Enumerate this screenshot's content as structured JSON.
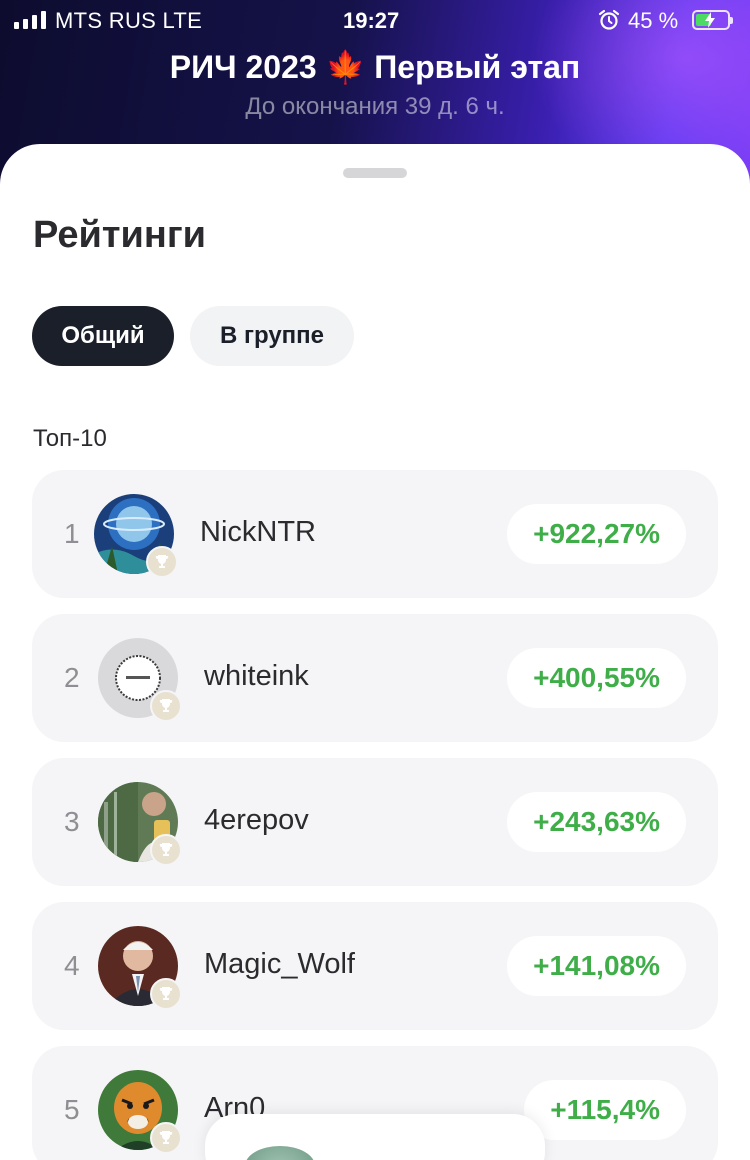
{
  "status_bar": {
    "carrier": "MTS RUS   LTE",
    "time": "19:27",
    "battery": "45 %",
    "alarm_icon": "alarm-clock-icon",
    "signal_icon": "signal-bars-icon",
    "battery_icon": "battery-charging-icon"
  },
  "header": {
    "title": "РИЧ 2023 🍁 Первый этап",
    "subtitle": "До окончания 39 д. 6 ч."
  },
  "sheet": {
    "heading": "Рейтинги",
    "tabs": [
      {
        "label": "Общий",
        "active": true
      },
      {
        "label": "В группе",
        "active": false
      }
    ],
    "section_label": "Топ-10"
  },
  "leaderboard": [
    {
      "rank": "1",
      "name": "NickNTR",
      "change": "+922,27%"
    },
    {
      "rank": "2",
      "name": "whiteink",
      "change": "+400,55%"
    },
    {
      "rank": "3",
      "name": "4erepov",
      "change": "+243,63%"
    },
    {
      "rank": "4",
      "name": "Magic_Wolf",
      "change": "+141,08%"
    },
    {
      "rank": "5",
      "name": "Arn0",
      "change": "+115,4%"
    }
  ],
  "colors": {
    "positive": "#3fae49",
    "tab_active_bg": "#1b1f2a",
    "row_bg": "#f5f5f7"
  }
}
